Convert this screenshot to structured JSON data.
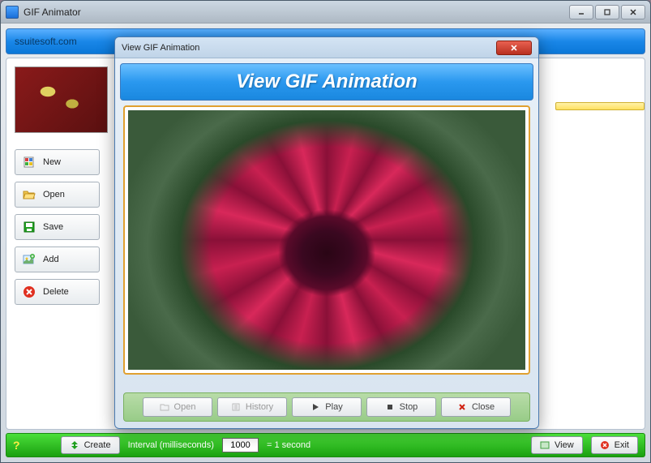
{
  "window": {
    "title": "GIF Animator"
  },
  "header": {
    "link": "ssuitesoft.com"
  },
  "sidebar": {
    "buttons": {
      "new": "New",
      "open": "Open",
      "save": "Save",
      "add": "Add",
      "delete": "Delete"
    }
  },
  "bottombar": {
    "help": "?",
    "create": "Create",
    "interval_label": "Interval (milliseconds)",
    "interval_value": "1000",
    "interval_suffix": "= 1 second",
    "view": "View",
    "exit": "Exit"
  },
  "modal": {
    "titlebar": "View GIF Animation",
    "header": "View GIF Animation",
    "buttons": {
      "open": "Open",
      "history": "History",
      "play": "Play",
      "stop": "Stop",
      "close": "Close"
    }
  }
}
